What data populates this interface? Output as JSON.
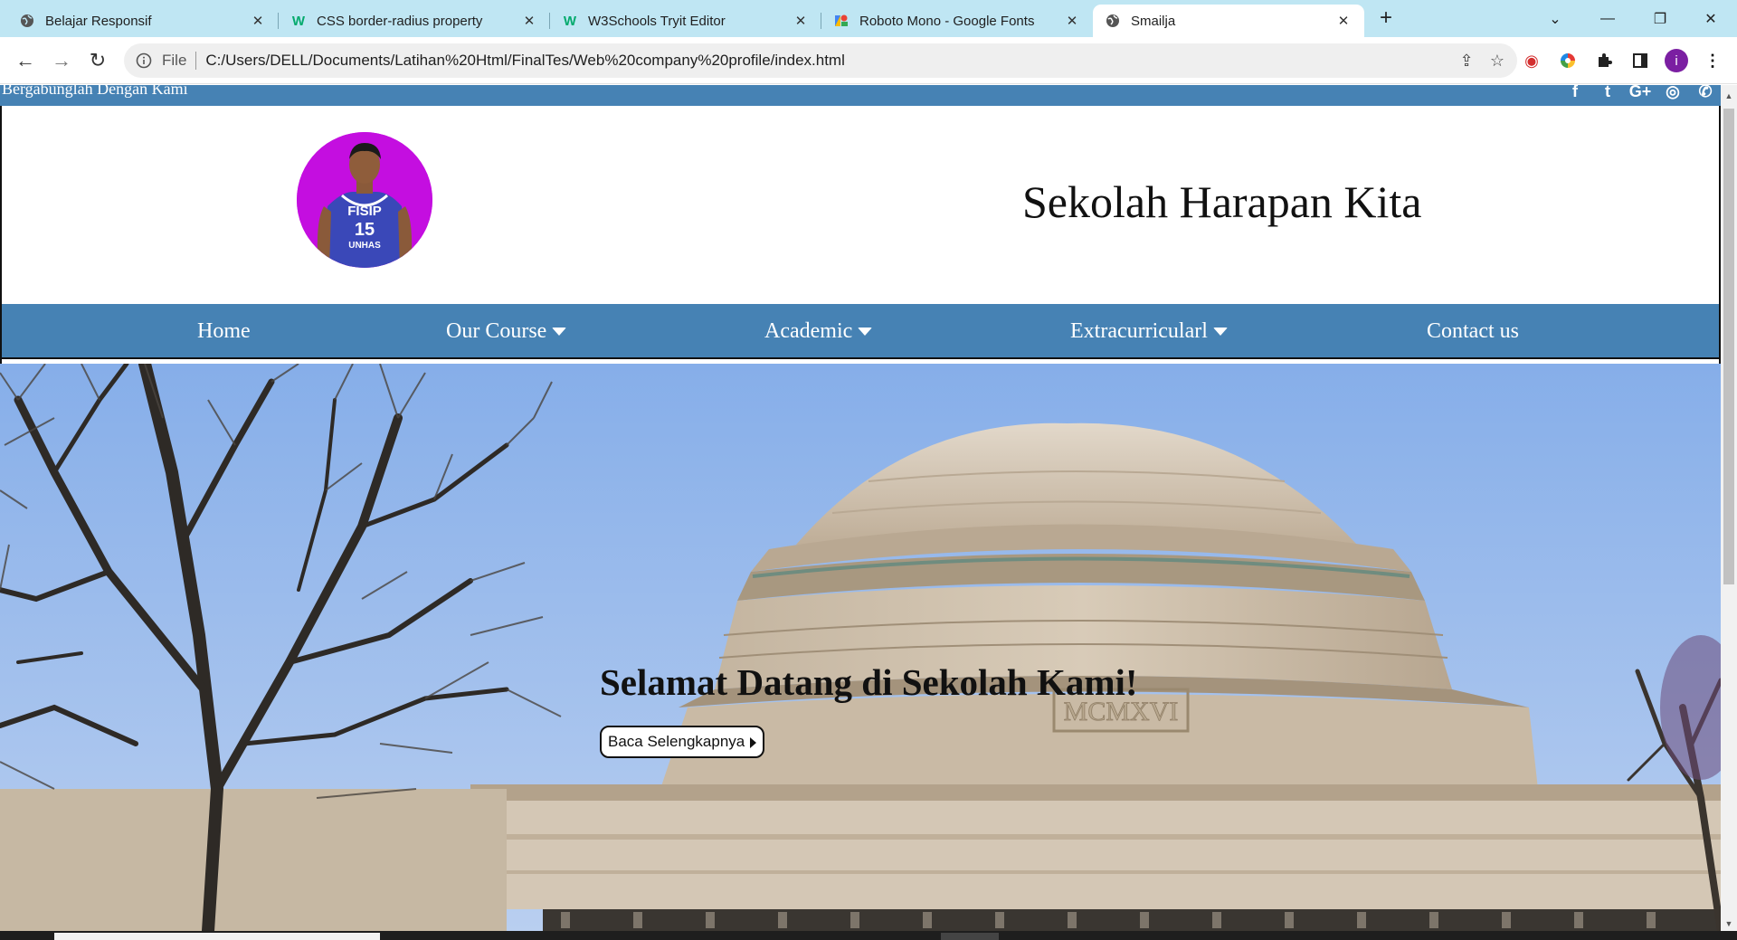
{
  "browser": {
    "tabs": [
      {
        "title": "Belajar Responsif",
        "favicon": "globe-icon"
      },
      {
        "title": "CSS border-radius property",
        "favicon": "w3schools-icon"
      },
      {
        "title": "W3Schools Tryit Editor",
        "favicon": "w3schools-icon"
      },
      {
        "title": "Roboto Mono - Google Fonts",
        "favicon": "google-fonts-icon"
      },
      {
        "title": "Smailja",
        "favicon": "globe-icon",
        "active": true
      }
    ],
    "address_scheme": "File",
    "address_url": "C:/Users/DELL/Documents/Latihan%20Html/FinalTes/Web%20company%20profile/index.html",
    "profile_initial": "i",
    "accent_tabstrip": "#bfe6f3"
  },
  "page": {
    "topbar": {
      "join_text": "Bergabunglah Dengan Kami",
      "social_icons": [
        "facebook-icon",
        "twitter-icon",
        "google-plus-icon",
        "instagram-icon",
        "whatsapp-icon"
      ],
      "social_glyphs": [
        "f",
        "t",
        "G+",
        "◎",
        "✆"
      ]
    },
    "site_title": "Sekolah Harapan Kita",
    "nav": [
      {
        "label": "Home",
        "dropdown": false
      },
      {
        "label": "Our Course",
        "dropdown": true
      },
      {
        "label": "Academic",
        "dropdown": true
      },
      {
        "label": "Extracurricularl",
        "dropdown": true
      },
      {
        "label": "Contact us",
        "dropdown": false
      }
    ],
    "hero": {
      "heading": "Selamat Datang di Sekolah Kami!",
      "button_label": "Baca Selengkapnya",
      "building_inscription": "MCMXVI"
    },
    "colors": {
      "nav_bg": "#4682b4",
      "logo_bg": "#c40ee0"
    }
  }
}
